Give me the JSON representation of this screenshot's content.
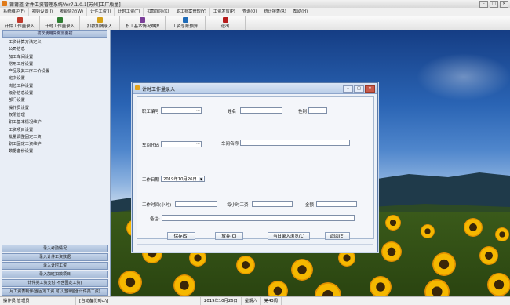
{
  "window": {
    "title": "莆莆道 计件工资管理系统Ver7.1.0.1[苏州]工厂版量]"
  },
  "menu": [
    "系统维护(F)",
    "初始设置(I)",
    "考勤情况(W)",
    "计件工资(J)",
    "计时工资(T)",
    "扣款加项(K)",
    "职工档案管理(Y)",
    "工资发放(P)",
    "查询(Q)",
    "统计报表(R)",
    "帮助(H)"
  ],
  "toolbar": [
    {
      "label": "计件工作量录入",
      "icon": "edit-icon",
      "color": "#c0392b",
      "width": 50
    },
    {
      "label": "计时工作量录入",
      "icon": "clock-icon",
      "color": "#2e7d32",
      "width": 50
    },
    {
      "label": "扣款加减录入",
      "icon": "money-icon",
      "color": "#d4a017",
      "width": 50
    },
    {
      "label": "职工基本情况维护",
      "icon": "person-icon",
      "color": "#7b3f99",
      "width": 57
    },
    {
      "label": "工资总账预算",
      "icon": "report-icon",
      "color": "#1e6bb8",
      "width": 50
    },
    {
      "label": "退出",
      "icon": "exit-icon",
      "color": "#b71c1c",
      "width": 50
    }
  ],
  "sidebar": {
    "header": "初次使用先做需要初",
    "items": [
      "工资计算方法定义",
      "公司信息",
      "加工车间设置",
      "常用工序设置",
      "产品及其工序工价设置",
      "班次设置",
      "岗位工种设置",
      "级别信息设置",
      "部门设置",
      "操作员设置",
      "权限管理",
      "职工基本情况维护",
      "工资项目设置",
      "批量调整固定工资",
      "职工固定工资维护",
      "数据备份设置"
    ],
    "bottom_buttons": [
      "录入考勤情况",
      "录入计件工资数据",
      "录入计时工资",
      "录入加班扣款项目",
      "计件类工资支付(不含固定工资)",
      "月工资表制作(含固定工资 可以选择包含计件类工资)"
    ]
  },
  "dialog": {
    "title": "计时工作量录入",
    "labels": {
      "emp_no": "职工编号",
      "name": "姓名",
      "gender": "性别",
      "workshop_code": "车间代码",
      "workshop_name": "车间名称",
      "work_date": "工作日期",
      "hours": "工作时间(小时)",
      "hourly_wage": "每小时工资",
      "amount": "金额",
      "remark": "备注:"
    },
    "values": {
      "work_date": "2019年10月26日"
    },
    "buttons": [
      "保存(S)",
      "放弃(C)",
      "当日录入浏览(L)",
      "返回(E)"
    ]
  },
  "status": [
    "操作员:管理员",
    "[自动备份到c:\\]",
    "2019年10月26日",
    "星期六",
    "第43周"
  ]
}
